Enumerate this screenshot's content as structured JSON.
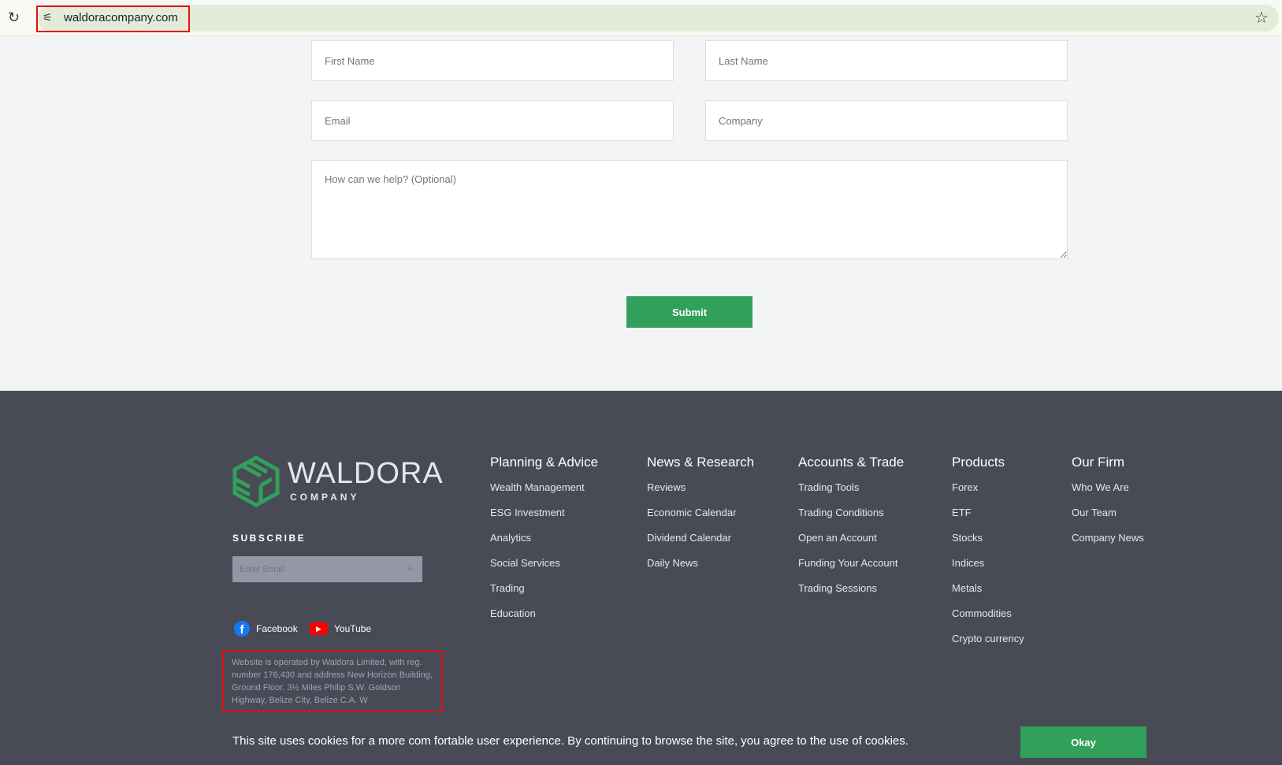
{
  "browser": {
    "url": "waldoracompany.com"
  },
  "form": {
    "first_name": "First Name",
    "last_name": "Last Name",
    "email": "Email",
    "company": "Company",
    "message": "How can we help? (Optional)",
    "submit": "Submit"
  },
  "footer": {
    "brand": {
      "name": "WALDORA",
      "sub": "COMPANY"
    },
    "subscribe_title": "SUBSCRIBE",
    "subscribe_placeholder": "Enter Email",
    "social": [
      "Facebook",
      "YouTube"
    ],
    "legal": "Website is operated by Waldora Limited, with reg. number 176,430 and address New Horizon Building, Ground Floor. 3½ Miles Philip S.W. Goldson Highway, Belize City, Belize C.A. W",
    "columns": [
      {
        "title": "Planning & Advice",
        "links": [
          "Wealth Management",
          "ESG Investment",
          "Analytics",
          "Social Services",
          "Trading",
          "Education"
        ]
      },
      {
        "title": "News & Research",
        "links": [
          "Reviews",
          "Economic Calendar",
          "Dividend Calendar",
          "Daily News"
        ]
      },
      {
        "title": "Accounts & Trade",
        "links": [
          "Trading Tools",
          "Trading Conditions",
          "Open an Account",
          "Funding Your Account",
          "Trading Sessions"
        ]
      },
      {
        "title": "Products",
        "links": [
          "Forex",
          "ETF",
          "Stocks",
          "Indices",
          "Metals",
          "Commodities",
          "Crypto currency"
        ]
      },
      {
        "title": "Our Firm",
        "links": [
          "Who We Are",
          "Our Team",
          "Company News"
        ]
      }
    ]
  },
  "cookie": {
    "text": "This site uses cookies for a more com fortable user experience. By continuing to browse the site, you agree to the use of cookies.",
    "button": "Okay"
  },
  "colors": {
    "accent": "#31a05a",
    "footer": "#484b56"
  }
}
